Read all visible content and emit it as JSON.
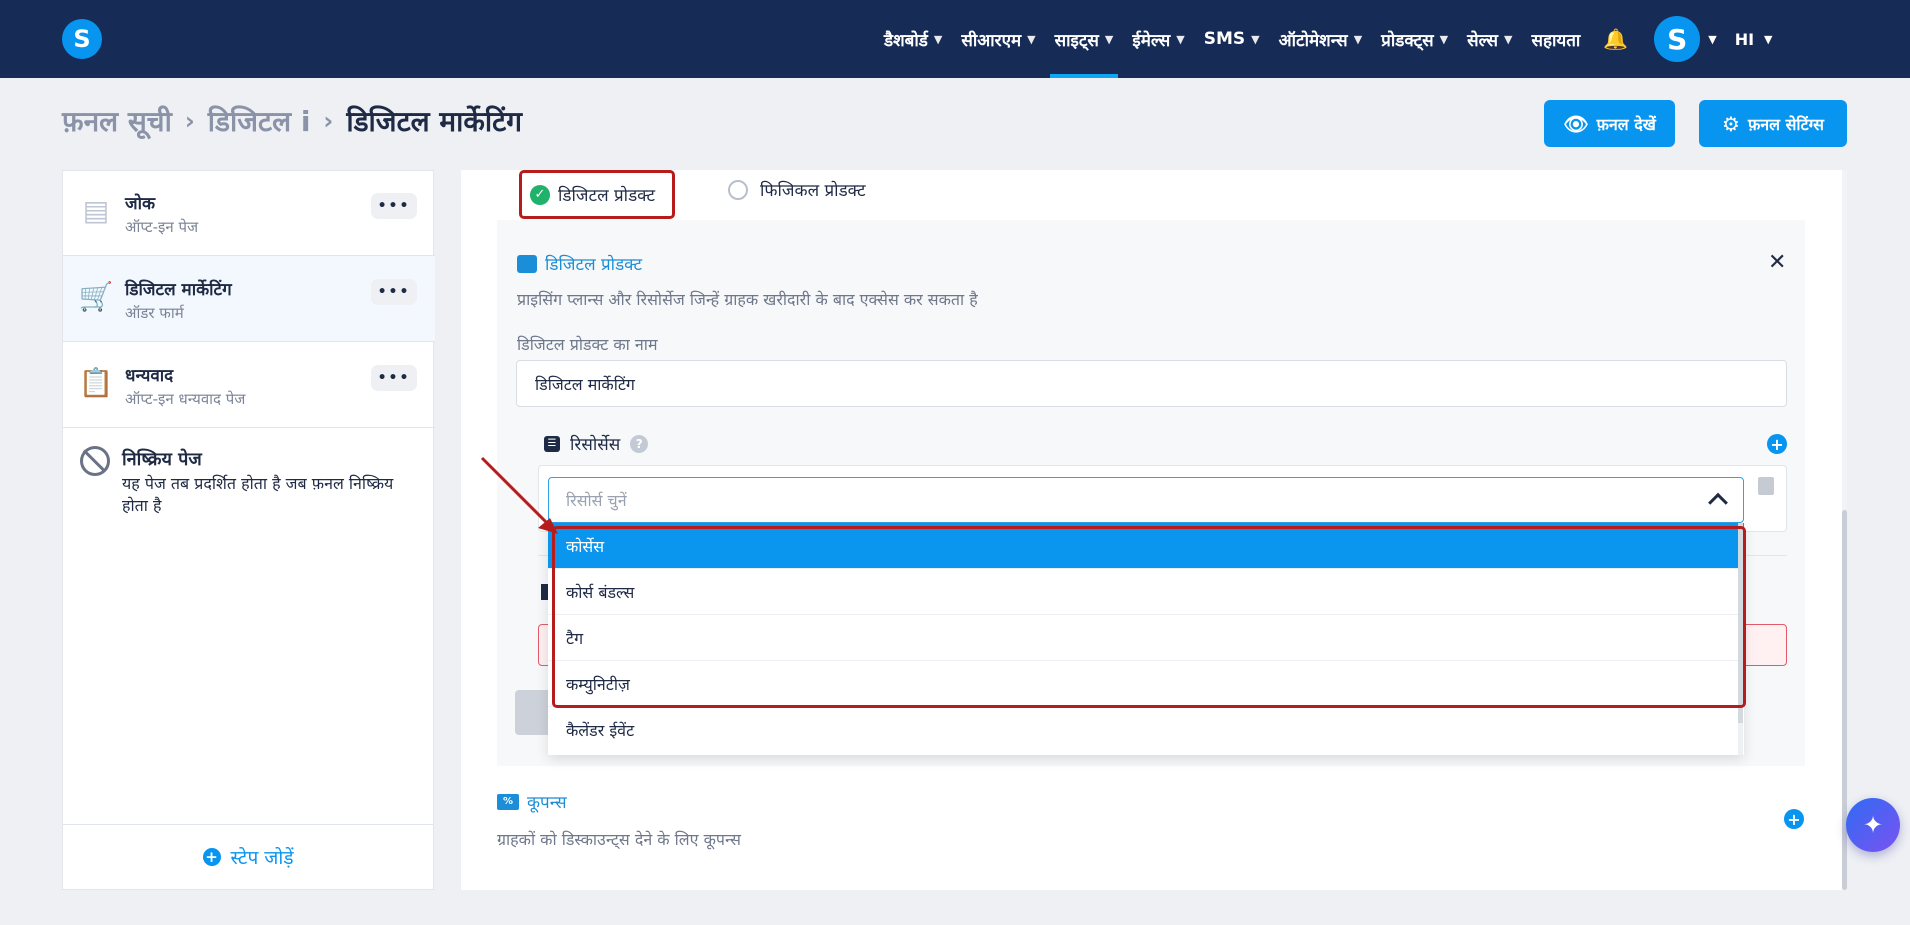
{
  "nav": {
    "items": [
      {
        "label": "डैशबोर्ड",
        "active": false
      },
      {
        "label": "सीआरएम",
        "active": false
      },
      {
        "label": "साइट्स",
        "active": true
      },
      {
        "label": "ईमेल्स",
        "active": false
      },
      {
        "label": "SMS",
        "active": false
      },
      {
        "label": "ऑटोमेशन्स",
        "active": false
      },
      {
        "label": "प्रोडक्ट्स",
        "active": false
      },
      {
        "label": "सेल्स",
        "active": false
      }
    ],
    "help_label": "सहायता",
    "logo_letter": "S",
    "avatar_letter": "S",
    "language": "HI",
    "accent_color": "#0795f0",
    "bg_color": "#172b57"
  },
  "breadcrumb": {
    "items": [
      "फ़नल सूची",
      "डिजिटल i"
    ],
    "current": "डिजिटल मार्केटिंग"
  },
  "header_buttons": {
    "view_funnel": "फ़नल देखें",
    "funnel_settings": "फ़नल सेटिंग्स"
  },
  "sidebar": {
    "steps": [
      {
        "title": "जोक",
        "subtitle": "ऑप्ट-इन पेज",
        "icon": "optin-page-icon",
        "selected": false
      },
      {
        "title": "डिजिटल मार्केटिंग",
        "subtitle": "ऑडर फार्म",
        "icon": "cart-icon",
        "selected": true
      },
      {
        "title": "धन्यवाद",
        "subtitle": "ऑप्ट-इन धन्यवाद पेज",
        "icon": "clipboard-check-icon",
        "selected": false
      }
    ],
    "inactive_title": "निष्क्रिय पेज",
    "inactive_desc": "यह पेज तब प्रदर्शित होता है जब फ़नल निष्क्रिय होता है",
    "add_step": "स्टेप जोड़ें"
  },
  "product_type": {
    "selected": "डिजिटल प्रोडक्ट",
    "other": "फिजिकल प्रोडक्ट"
  },
  "digital_product": {
    "title": "डिजिटल प्रोडक्ट",
    "description": "प्राइसिंग प्लान्स और रिसोर्सेज जिन्हें ग्राहक खरीदारी के बाद एक्सेस कर सकता है",
    "name_label": "डिजिटल प्रोडक्ट का नाम",
    "name_value": "डिजिटल मार्केटिंग",
    "resources_label": "रिसोर्सेस",
    "resource_placeholder": "रिसोर्स चुनें",
    "options": [
      {
        "label": "कोर्सेस",
        "highlighted": true
      },
      {
        "label": "कोर्स बंडल्स",
        "highlighted": false
      },
      {
        "label": "टैग",
        "highlighted": false
      },
      {
        "label": "कम्युनिटीज़",
        "highlighted": false
      },
      {
        "label": "कैलेंडर ईवेंट",
        "highlighted": false
      }
    ]
  },
  "coupons": {
    "title": "कूपन्स",
    "description": "ग्राहकों को डिस्काउन्ट्स देने के लिए कूपन्स"
  }
}
